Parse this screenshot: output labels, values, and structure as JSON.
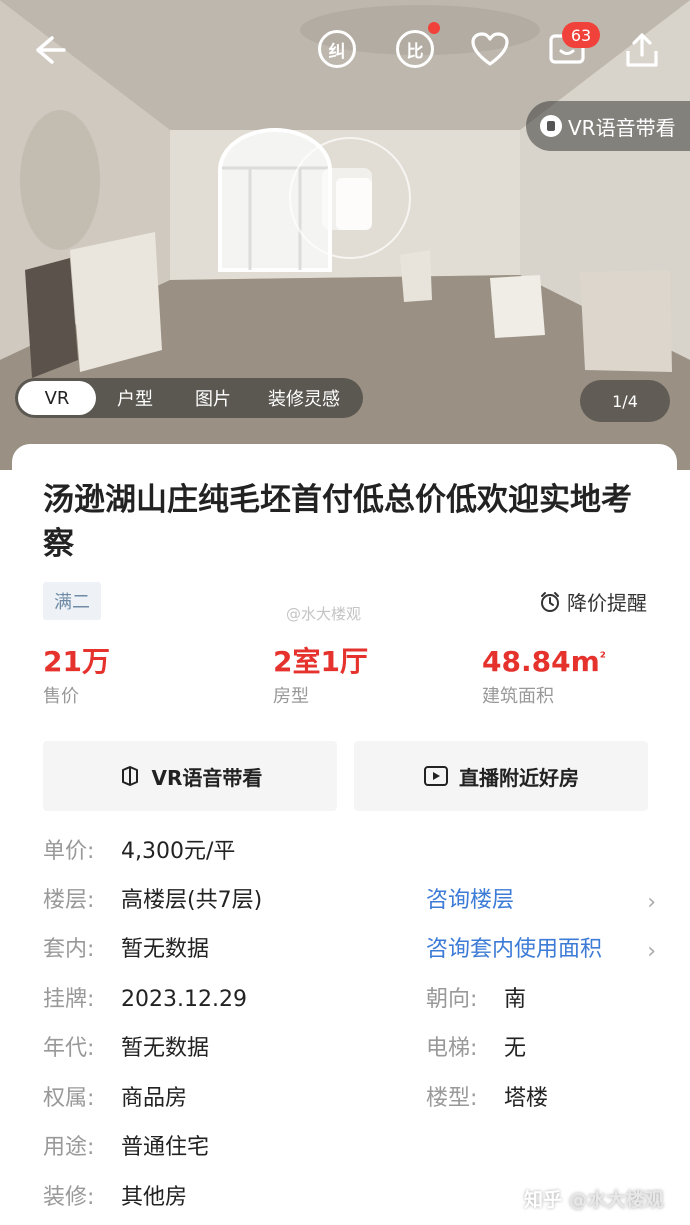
{
  "header": {
    "badge_jiu": "纠",
    "badge_bi": "比",
    "message_count": "63",
    "vr_pill_label": "VR语音带看",
    "icons": [
      "back-arrow-icon",
      "heart-icon",
      "message-icon",
      "share-icon"
    ]
  },
  "media_tabs": [
    {
      "label": "VR"
    },
    {
      "label": "户型"
    },
    {
      "label": "图片"
    },
    {
      "label": "装修灵感"
    }
  ],
  "page_indicator": "1/4",
  "listing": {
    "title": "汤逊湖山庄纯毛坯首付低总价低欢迎实地考察",
    "tag": "满二",
    "price_alert": "降价提醒",
    "watermark": "@水大楼观",
    "stats": [
      {
        "value": "21万",
        "label": "售价"
      },
      {
        "value": "2室1厅",
        "label": "房型"
      },
      {
        "value": "48.84m",
        "sup": "²",
        "label": "建筑面积"
      }
    ],
    "actions": [
      {
        "label": "VR语音带看"
      },
      {
        "label": "直播附近好房"
      }
    ],
    "details": [
      {
        "key": "单价:",
        "value": "4,300元/平"
      },
      {
        "key": "楼层:",
        "value": "高楼层(共7层)"
      },
      {
        "key": "套内:",
        "value": "暂无数据"
      },
      {
        "key": "挂牌:",
        "value": "2023.12.29"
      },
      {
        "key": "年代:",
        "value": "暂无数据"
      },
      {
        "key": "权属:",
        "value": "商品房"
      },
      {
        "key": "用途:",
        "value": "普通住宅"
      },
      {
        "key": "装修:",
        "value": "其他房"
      }
    ],
    "side_details": [
      {
        "key": "朝向:",
        "value": "南"
      },
      {
        "key": "电梯:",
        "value": "无"
      },
      {
        "key": "楼型:",
        "value": "塔楼"
      }
    ],
    "links": [
      {
        "label": "咨询楼层"
      },
      {
        "label": "咨询套内使用面积"
      }
    ]
  },
  "footer_watermark": {
    "brand": "知乎",
    "handle": "@水大楼观"
  },
  "colors": {
    "accent_red": "#e5322d",
    "link_blue": "#3c7bd6",
    "tag_bg": "#eef2f7"
  }
}
